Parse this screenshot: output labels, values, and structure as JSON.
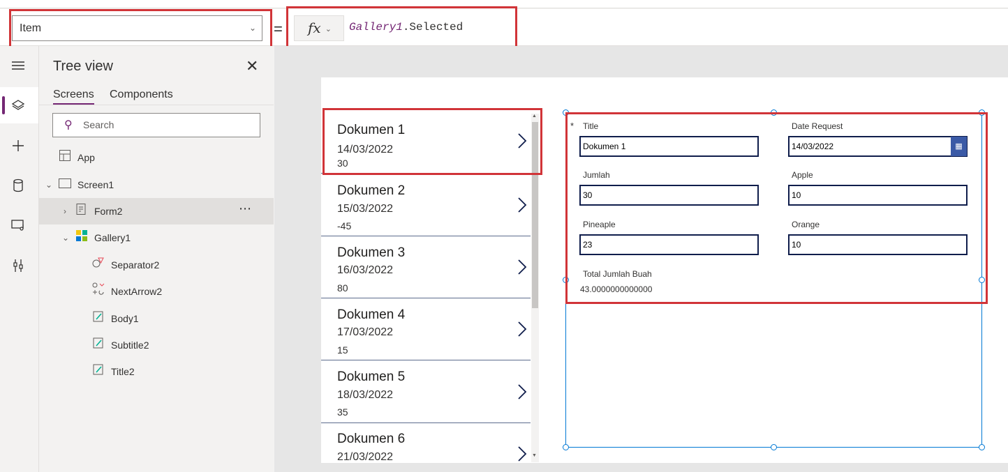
{
  "formula_bar": {
    "property": "Item",
    "equals": "=",
    "fx_label": "fx",
    "formula_control": "Gallery1",
    "formula_rest": ".Selected"
  },
  "left_rail": {
    "icons": [
      "hamburger-icon",
      "layers-icon",
      "plus-icon",
      "database-icon",
      "media-icon",
      "tools-icon"
    ]
  },
  "tree_view": {
    "title": "Tree view",
    "tabs": [
      "Screens",
      "Components"
    ],
    "search_placeholder": "Search",
    "items": [
      {
        "label": "App"
      },
      {
        "label": "Screen1"
      },
      {
        "label": "Form2"
      },
      {
        "label": "Gallery1"
      },
      {
        "label": "Separator2"
      },
      {
        "label": "NextArrow2"
      },
      {
        "label": "Body1"
      },
      {
        "label": "Subtitle2"
      },
      {
        "label": "Title2"
      }
    ]
  },
  "gallery": {
    "items": [
      {
        "title": "Dokumen 1",
        "subtitle": "14/03/2022",
        "body": "30"
      },
      {
        "title": "Dokumen 2",
        "subtitle": "15/03/2022",
        "body": "-45"
      },
      {
        "title": "Dokumen 3",
        "subtitle": "16/03/2022",
        "body": "80"
      },
      {
        "title": "Dokumen 4",
        "subtitle": "17/03/2022",
        "body": "15"
      },
      {
        "title": "Dokumen 5",
        "subtitle": "18/03/2022",
        "body": "35"
      },
      {
        "title": "Dokumen 6",
        "subtitle": "21/03/2022",
        "body": ""
      }
    ]
  },
  "form": {
    "required_mark": "*",
    "fields": {
      "title": {
        "label": "Title",
        "value": "Dokumen 1"
      },
      "date_request": {
        "label": "Date Request",
        "value": "14/03/2022"
      },
      "jumlah": {
        "label": "Jumlah",
        "value": "30"
      },
      "apple": {
        "label": "Apple",
        "value": "10"
      },
      "pineaple": {
        "label": "Pineaple",
        "value": "23"
      },
      "orange": {
        "label": "Orange",
        "value": "10"
      },
      "total": {
        "label": "Total Jumlah Buah",
        "value": "43.0000000000000"
      }
    }
  },
  "colors": {
    "accent": "#742774",
    "highlight_box": "#d13438",
    "selection": "#0078d4",
    "date_button": "#3b5aa6"
  }
}
